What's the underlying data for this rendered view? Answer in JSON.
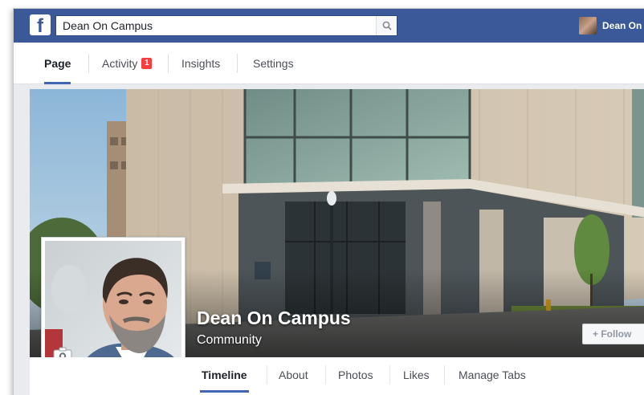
{
  "topbar": {
    "logo": "f",
    "search_value": "Dean On Campus",
    "user_name": "Dean On"
  },
  "page_tabs": [
    {
      "label": "Page",
      "active": true
    },
    {
      "label": "Activity",
      "badge": "1"
    },
    {
      "label": "Insights"
    },
    {
      "label": "Settings"
    }
  ],
  "page": {
    "name": "Dean On Campus",
    "category": "Community",
    "follow_label": "+ Follow"
  },
  "timeline_tabs": [
    {
      "label": "Timeline",
      "active": true
    },
    {
      "label": "About"
    },
    {
      "label": "Photos"
    },
    {
      "label": "Likes"
    },
    {
      "label": "Manage Tabs"
    }
  ],
  "colors": {
    "brand": "#3b5998",
    "badge": "#fa3e3e",
    "active_underline": "#4267b2"
  },
  "icons": [
    "facebook-logo-icon",
    "search-icon",
    "camera-icon"
  ]
}
